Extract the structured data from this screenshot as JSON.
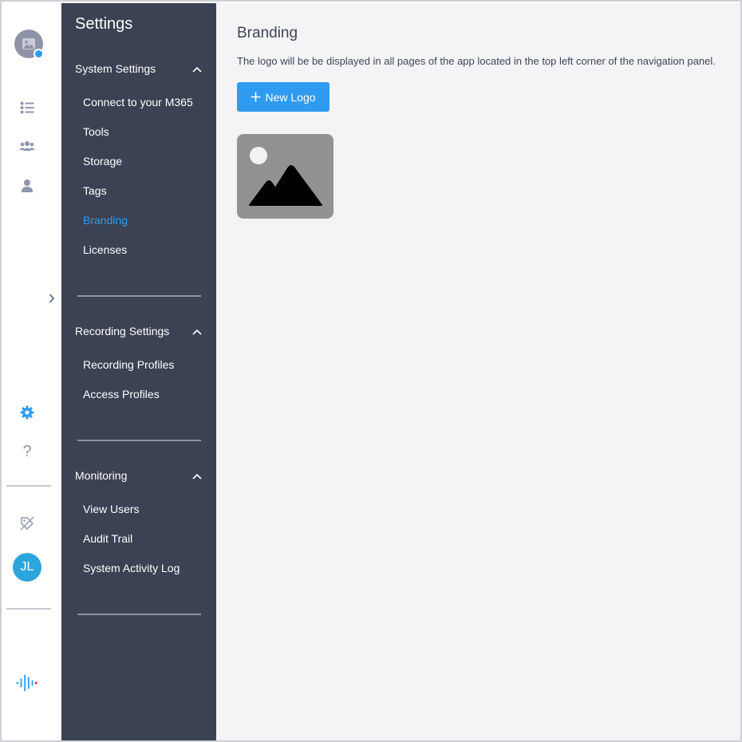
{
  "rail": {
    "user_initials": "JL",
    "help_glyph": "?",
    "icons": [
      "image-avatar-icon",
      "list-icon",
      "group-icon",
      "user-icon",
      "gear-icon",
      "help-icon",
      "tag-icon",
      "audio-logo-icon"
    ],
    "accent_color": "#2f9bf0"
  },
  "settings": {
    "title": "Settings",
    "sections": [
      {
        "label": "System Settings",
        "items": [
          {
            "label": "Connect to your M365"
          },
          {
            "label": "Tools"
          },
          {
            "label": "Storage"
          },
          {
            "label": "Tags"
          },
          {
            "label": "Branding",
            "active": true
          },
          {
            "label": "Licenses"
          }
        ]
      },
      {
        "label": "Recording Settings",
        "items": [
          {
            "label": "Recording Profiles"
          },
          {
            "label": "Access Profiles"
          }
        ]
      },
      {
        "label": "Monitoring",
        "items": [
          {
            "label": "View Users"
          },
          {
            "label": "Audit Trail"
          },
          {
            "label": "System Activity Log"
          }
        ]
      }
    ]
  },
  "main": {
    "title": "Branding",
    "description": "The logo will be be displayed in all pages of the app located in the top left corner of the navigation panel.",
    "new_logo_label": "New Logo",
    "new_logo_icon": "plus-icon",
    "logo_placeholder_icon": "image-placeholder-icon"
  },
  "colors": {
    "sidebar_bg": "#3a4253",
    "main_bg": "#f4f4f7",
    "active_text": "#2f9bf0",
    "button_bg": "#2f9bf0"
  }
}
